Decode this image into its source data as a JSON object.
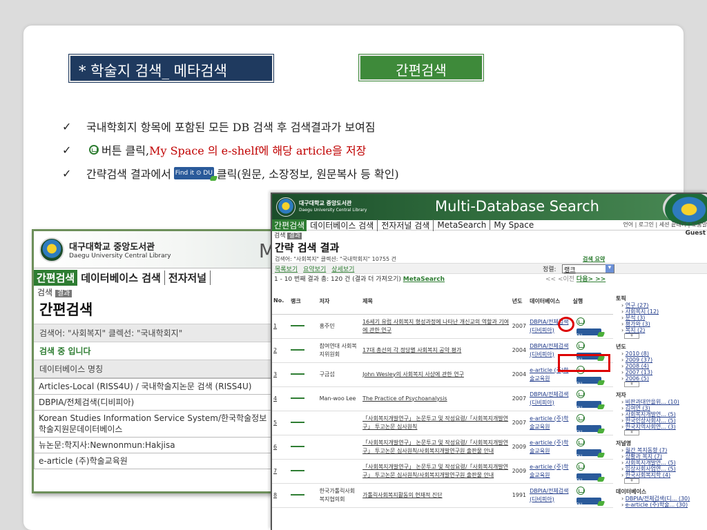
{
  "slide": {
    "title": "* 학술지 검색_ 메타검색",
    "quick_label": "간편검색",
    "bullets": [
      {
        "check": "✓",
        "text": "국내학회지 항목에 포함된 모든 DB 검색 후 검색결과가 보여짐"
      },
      {
        "check": "✓",
        "pre": "버튼 클릭, ",
        "red": "My Space 의 e-shelf에 해당 article을 저장"
      },
      {
        "check": "✓",
        "pre": "간략검색 결과에서",
        "post": "클릭(원문, 소장정보, 원문복사 등 확인)"
      }
    ],
    "findit_label": "Find it ⊙ DU"
  },
  "left": {
    "lib_ko": "대구대학교 중앙도서관",
    "lib_en": "Daegu University Central Library",
    "m_letter": "M",
    "nav": [
      "간편검색",
      "데이터베이스 검색",
      "전자저널"
    ],
    "sub_search": "검색",
    "sub_result": "결과",
    "heading": "간편검색",
    "query": "검색어: \"사회복지\" 클렉선: \"국내학회지\"",
    "status": "검색 중 입니다",
    "db_header": "데이터베이스 명칭",
    "dbs": [
      "Articles-Local (RISS4U) / 국내학술지논문 검색 (RISS4U)",
      "DBPIA/전체검색(디비피아)",
      "Korean Studies Information Service System/한국학술정보",
      "학술지원문데이터베이스",
      "뉴논문:학지사:Newnonmun:Hakjisa",
      "e-article (주)학술교육원"
    ]
  },
  "right": {
    "lib_ko": "대구대학교 중앙도서관",
    "lib_en": "Daegu University Central Library",
    "title": "Multi-Database Search",
    "nav": [
      "간편검색",
      "데이터베이스 검색",
      "전자저널 검색",
      "MetaSearch",
      "My Space"
    ],
    "util": "언어 | 로그인 | 세션 끝내기 | 도움말",
    "guest": "Guest",
    "sub_search": "검색",
    "sub_result": "결과",
    "heading": "간략 검색 결과",
    "query": "검색어: \"사회복지\" 클렉션: \"국내학회지\" 10755 건",
    "summary_link": "검색 요약",
    "tabs": [
      "목록보기",
      "요약보기",
      "상세보기"
    ],
    "sort_label": "정렬:",
    "sort_value": "랭크",
    "count_text": "1 - 10 번째 결과 총: 120 건 (결과 더 가져오기)",
    "metasearch_link": "MetaSearch",
    "prev": "<< <이전",
    "next": "다음> >>",
    "columns": [
      "No.",
      "랭크",
      "저자",
      "제목",
      "년도",
      "데이터베이스",
      "실행"
    ],
    "rows": [
      {
        "no": "1",
        "author": "홍주민",
        "title": "16세기 유럽 사회복지 형성과정에 나타난 개신교의 역할과 기여에 관한 연구",
        "year": "2007",
        "db": "DBPIA/전체검색(디비피아)"
      },
      {
        "no": "2",
        "author": "참여연대 사회복지위원회",
        "title": "17대 총선의 각 정당별 사회복지 공약 평가",
        "year": "2004",
        "db": "DBPIA/전체검색(디비피아)"
      },
      {
        "no": "3",
        "author": "구금섭",
        "title": "John Wesley의 사회복지 사상에 관한 연구",
        "year": "2004",
        "db": "e-article (주)학술교육원"
      },
      {
        "no": "4",
        "author": "Man-woo Lee",
        "title": "The Practice of Psychoanalysis",
        "year": "2007",
        "db": "DBPIA/전체검색(디비피아)"
      },
      {
        "no": "5",
        "author": "",
        "title": "「사회복지개발연구」 논문투고 및 작성요령/「사회복지개발연구」 투고논문 심사원칙",
        "year": "2007",
        "db": "e-article (주)학술교육원"
      },
      {
        "no": "6",
        "author": "",
        "title": "「사회복지개발연구」 논문투고 및 작성요령/「사회복지개발연구」 투고논문 심사원칙/사회복지개발연구원 출판물 안내",
        "year": "2009",
        "db": "e-article (주)학술교육원"
      },
      {
        "no": "7",
        "author": "",
        "title": "「사회복지개발연구」 논문투고 및 작성요령/「사회복지개발연구」 투고논문 심사원칙/사회복지개발연구원 출판물 안내",
        "year": "2009",
        "db": "e-article (주)학술교육원"
      },
      {
        "no": "8",
        "author": "한국가톨릭사회복지협의회",
        "title": "가톨릭사회복지활동의 현재적 진단",
        "year": "1991",
        "db": "DBPIA/전체검색(디비피아)"
      }
    ],
    "facets": [
      {
        "title": "토픽",
        "items": [
          "연구 (27)",
          "사회복지 (12)",
          "분석 (3)",
          "평가와 (3)",
          "복지 (2)"
        ]
      },
      {
        "title": "년도",
        "items": [
          "2010 (8)",
          "2009 (37)",
          "2008 (4)",
          "2007 (13)",
          "2006 (5)"
        ]
      },
      {
        "title": "저자",
        "items": [
          "비판과대안을위... (10)",
          "김여연 (3)",
          "사회복지개발연... (5)",
          "한국인상사회사... (5)",
          "한국지역사회연... (3)"
        ]
      },
      {
        "title": "저널명",
        "items": [
          "월간 복지동향 (7)",
          "상황과 복지 (7)",
          "사회복지개발연... (5)",
          "임상사회사업연... (5)",
          "한국사회복지학 (4)"
        ]
      },
      {
        "title": "데이터베이스",
        "items": [
          "DBPIA/전체검색(디... (30)",
          "e-article (주)학술... (30)"
        ]
      }
    ],
    "findit_label": "Find it ⊙ DU"
  },
  "colors": {
    "slide_title_bg": "#1f3a5f",
    "quick_bg": "#3e8a3a",
    "accent_green": "#2e7d32",
    "highlight_red": "#d00000"
  }
}
